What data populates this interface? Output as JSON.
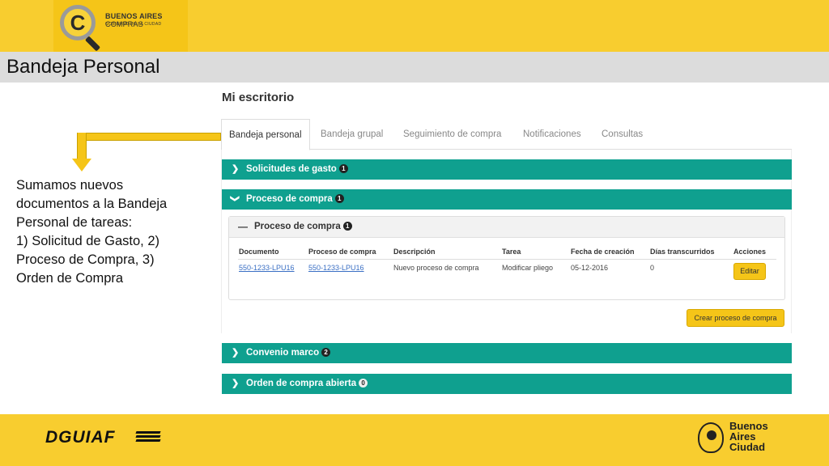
{
  "header": {
    "logo_name": "BUENOS AIRES",
    "logo_name_suffix": " COMPRAS",
    "logo_subtitle": "GOBIERNO DE LA CIUDAD",
    "logo_letter": "C",
    "page_title": "Bandeja Personal"
  },
  "annotation": {
    "text": "Sumamos nuevos\ndocumentos a la Bandeja\nPersonal de tareas:\n1) Solicitud de Gasto, 2)\nProceso de Compra, 3)\nOrden de Compra"
  },
  "main": {
    "section_title": "Mi escritorio",
    "tabs": [
      {
        "label": "Bandeja personal"
      },
      {
        "label": "Bandeja grupal"
      },
      {
        "label": "Seguimiento de compra"
      },
      {
        "label": "Notificaciones"
      },
      {
        "label": "Consultas"
      }
    ],
    "accordions": [
      {
        "label": "Solicitudes de gasto",
        "count": "1",
        "expanded": false
      },
      {
        "label": "Proceso de compra",
        "count": "1",
        "expanded": true
      },
      {
        "label": "Convenio marco",
        "count": "2",
        "expanded": false
      },
      {
        "label": "Orden de compra abierta",
        "count": "0",
        "expanded": false
      }
    ],
    "inner_panel": {
      "label": "Proceso de compra",
      "count": "1"
    },
    "table": {
      "headers": [
        "Documento",
        "Proceso de compra",
        "Descripción",
        "Tarea",
        "Fecha de creación",
        "Días transcurridos",
        "Acciones"
      ],
      "rows": [
        {
          "documento": "550-1233-LPU16",
          "proceso": "550-1233-LPU16",
          "descripcion": "Nuevo proceso de compra",
          "tarea": "Modificar pliego",
          "fecha": "05-12-2016",
          "dias": "0",
          "accion": "Editar"
        }
      ]
    },
    "create_button": "Crear proceso de compra"
  },
  "footer": {
    "left_brand": "DGUIAF",
    "right_brand_line1": "Buenos",
    "right_brand_line2": "Aires",
    "right_brand_line3": "Ciudad"
  },
  "colors": {
    "brand_yellow": "#f8cd2f",
    "accordion_teal": "#0fa08f",
    "link_blue": "#3a6fc4"
  }
}
